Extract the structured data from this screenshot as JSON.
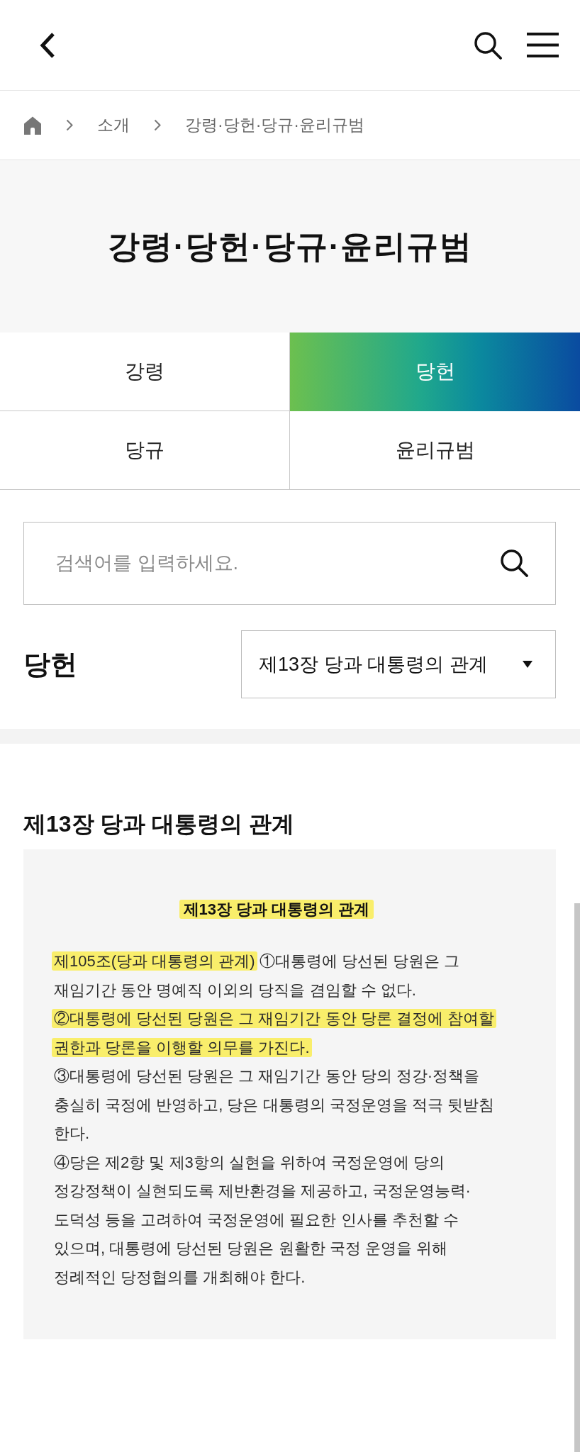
{
  "breadcrumb": [
    "소개",
    "강령·당헌·당규·윤리규범"
  ],
  "page_title": "강령·당헌·당규·윤리규범",
  "tabs": [
    {
      "label": "강령",
      "selected": false
    },
    {
      "label": "당헌",
      "selected": true
    },
    {
      "label": "당규",
      "selected": false
    },
    {
      "label": "윤리규범",
      "selected": false
    }
  ],
  "search": {
    "placeholder": "검색어를 입력하세요."
  },
  "section": {
    "title": "당헌",
    "select_value": "제13장 당과 대통령의 관계"
  },
  "chapter": {
    "title": "제13장 당과 대통령의 관계",
    "box_heading": {
      "text": "제13장 당과 대통령의 관계",
      "highlighted": true
    },
    "paragraphs": [
      {
        "segments": [
          {
            "text": "제105조(당과 대통령의 관계)",
            "highlighted": true
          },
          {
            "text": "①대통령에 당선된 당원은 그 재임기간 동안 명예직 이외의 당직을 겸임할 수 없다.",
            "highlighted": false
          }
        ]
      },
      {
        "segments": [
          {
            "text": "②대통령에 당선된 당원은 그 재임기간 동안 당론 결정에 참여할 권한과 당론을 이행할 의무를 가진다.",
            "highlighted": true
          }
        ]
      },
      {
        "segments": [
          {
            "text": "③대통령에 당선된 당원은 그 재임기간 동안 당의 정강·정책을 충실히 국정에 반영하고, 당은 대통령의 국정운영을 적극 뒷받침 한다.",
            "highlighted": false
          }
        ]
      },
      {
        "segments": [
          {
            "text": "④당은 제2항 및 제3항의 실현을 위하여 국정운영에 당의 정강정책이 실현되도록 제반환경을 제공하고, 국정운영능력·도덕성 등을 고려하여 국정운영에 필요한 인사를 추천할 수 있으며, 대통령에 당선된 당원은 원활한 국정 운영을 위해 정례적인 당정협의를 개최해야 한다.",
            "highlighted": false
          }
        ]
      }
    ]
  }
}
